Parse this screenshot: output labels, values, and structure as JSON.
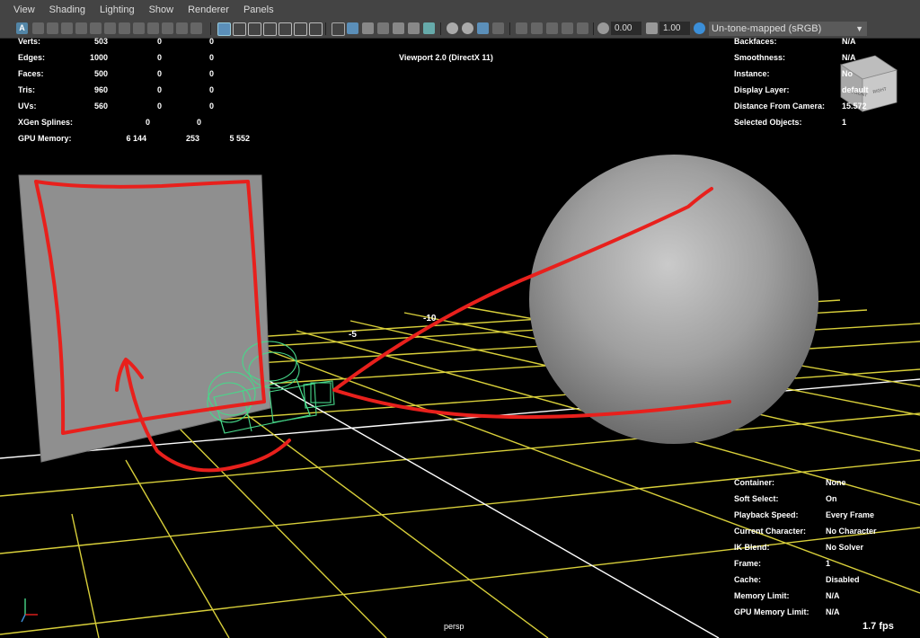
{
  "menu": [
    "View",
    "Shading",
    "Lighting",
    "Show",
    "Renderer",
    "Panels"
  ],
  "toolbar": {
    "exposure": "0.00",
    "gamma": "1.00",
    "color_space": "Un-tone-mapped (sRGB)",
    "icons": [
      "camera-icon",
      "camera-attributes-icon",
      "bookmark-icon",
      "image-plane-icon",
      "grid-icon",
      "film-gate-icon",
      "resolution-gate-icon",
      "gate-mask-icon",
      "field-chart-icon",
      "safe-action-icon",
      "safe-title-icon",
      "wireframe-icon",
      "smooth-shade-icon",
      "default-material-icon",
      "textured-icon",
      "use-all-lights-icon",
      "shadows-icon",
      "screen-space-ao-icon",
      "motion-blur-icon",
      "anti-aliasing-icon",
      "depth-of-field-icon",
      "isolate-select-icon",
      "x-ray-icon",
      "x-ray-joints-icon",
      "x-ray-active-icon",
      "exposure-icon",
      "gamma-icon",
      "color-management-icon"
    ]
  },
  "viewport": {
    "title": "Viewport 2.0 (DirectX 11)",
    "camera_name": "persp",
    "fps": "1.7 fps",
    "view_cube_front": "FRONT",
    "view_cube_right": "RIGHT",
    "grid_labels": [
      "-5",
      "-10"
    ]
  },
  "stats": {
    "rows": [
      {
        "label": "Verts:",
        "v1": "503",
        "v2": "0",
        "v3": "0"
      },
      {
        "label": "Edges:",
        "v1": "1000",
        "v2": "0",
        "v3": "0"
      },
      {
        "label": "Faces:",
        "v1": "500",
        "v2": "0",
        "v3": "0"
      },
      {
        "label": "Tris:",
        "v1": "960",
        "v2": "0",
        "v3": "0"
      },
      {
        "label": "UVs:",
        "v1": "560",
        "v2": "0",
        "v3": "0"
      }
    ],
    "xgen": {
      "label": "XGen Splines:",
      "v1": "0",
      "v2": "0"
    },
    "gpu": {
      "label": "GPU Memory:",
      "v1": "6 144",
      "v2": "253",
      "v3": "5 552"
    }
  },
  "object_info": [
    {
      "label": "Backfaces:",
      "value": "N/A"
    },
    {
      "label": "Smoothness:",
      "value": "N/A"
    },
    {
      "label": "Instance:",
      "value": "No"
    },
    {
      "label": "Display Layer:",
      "value": "default"
    },
    {
      "label": "Distance From Camera:",
      "value": "15.572"
    },
    {
      "label": "Selected Objects:",
      "value": "1"
    }
  ],
  "scene_info": [
    {
      "label": "Container:",
      "value": "None"
    },
    {
      "label": "Soft Select:",
      "value": "On"
    },
    {
      "label": "Playback Speed:",
      "value": "Every Frame"
    },
    {
      "label": "Current Character:",
      "value": "No Character"
    },
    {
      "label": "IK Blend:",
      "value": "No Solver"
    },
    {
      "label": "Frame:",
      "value": "1"
    },
    {
      "label": "Cache:",
      "value": "Disabled"
    },
    {
      "label": "Memory Limit:",
      "value": "N/A"
    },
    {
      "label": "GPU Memory Limit:",
      "value": "N/A"
    }
  ],
  "colors": {
    "grid_white": "#ffffff",
    "grid_yellow": "#d8cf3a",
    "annotation_red": "#e8201c",
    "camera_wire": "#47d88a",
    "plane": "#8f8f8f"
  }
}
